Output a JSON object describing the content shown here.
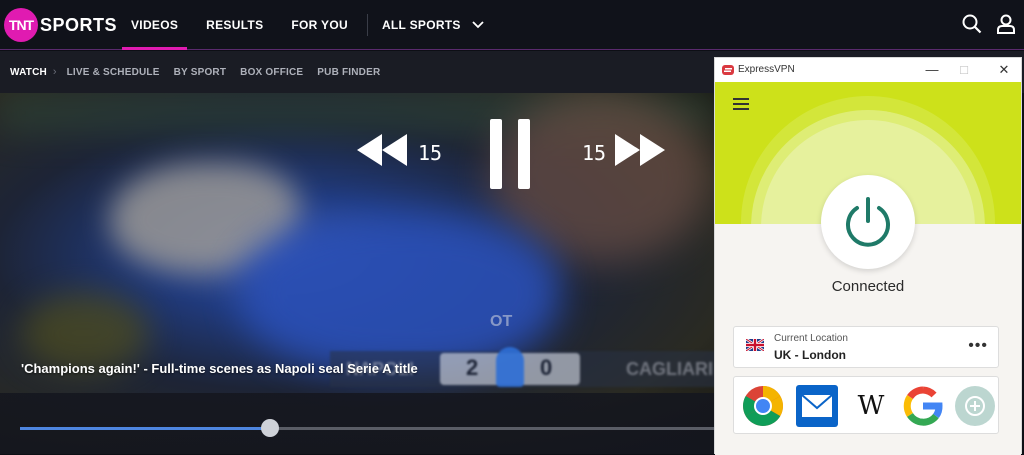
{
  "header": {
    "logo_badge": "TNT",
    "logo_text": "SPORTS",
    "nav": [
      {
        "label": "VIDEOS",
        "active": true
      },
      {
        "label": "RESULTS",
        "active": false
      },
      {
        "label": "FOR YOU",
        "active": false
      }
    ],
    "all_sports_label": "ALL SPORTS",
    "icons": [
      "search-icon",
      "user-icon",
      "chevron-down-icon"
    ]
  },
  "subnav": {
    "items": [
      {
        "label": "WATCH",
        "active": true
      },
      {
        "label": "LIVE & SCHEDULE",
        "active": false
      },
      {
        "label": "BY SPORT",
        "active": false
      },
      {
        "label": "BOX OFFICE",
        "active": false
      },
      {
        "label": "PUB FINDER",
        "active": false
      }
    ]
  },
  "video": {
    "caption": "'Champions again!' - Full-time scenes as Napoli seal Serie A title",
    "rewind_seconds": "15",
    "forward_seconds": "15",
    "scoreboard": {
      "home": "NAPOLI",
      "home_score": "2",
      "away_score": "0",
      "away": "CAGLIARI"
    },
    "watermark": "OT",
    "progress_fraction": 0.36,
    "accent_color": "#4e86e0"
  },
  "vpn": {
    "title": "ExpressVPN",
    "status": "Connected",
    "location_label": "Current Location",
    "location_value": "UK - London",
    "more_label": "•••",
    "hero_color": "#cde11a",
    "brand_color": "#da3940",
    "shortcuts": [
      "chrome-icon",
      "mail-icon",
      "wikipedia-icon",
      "google-icon",
      "add-shortcut-icon"
    ],
    "wikipedia_glyph": "W",
    "window_controls": [
      "minimize",
      "maximize",
      "close"
    ]
  }
}
